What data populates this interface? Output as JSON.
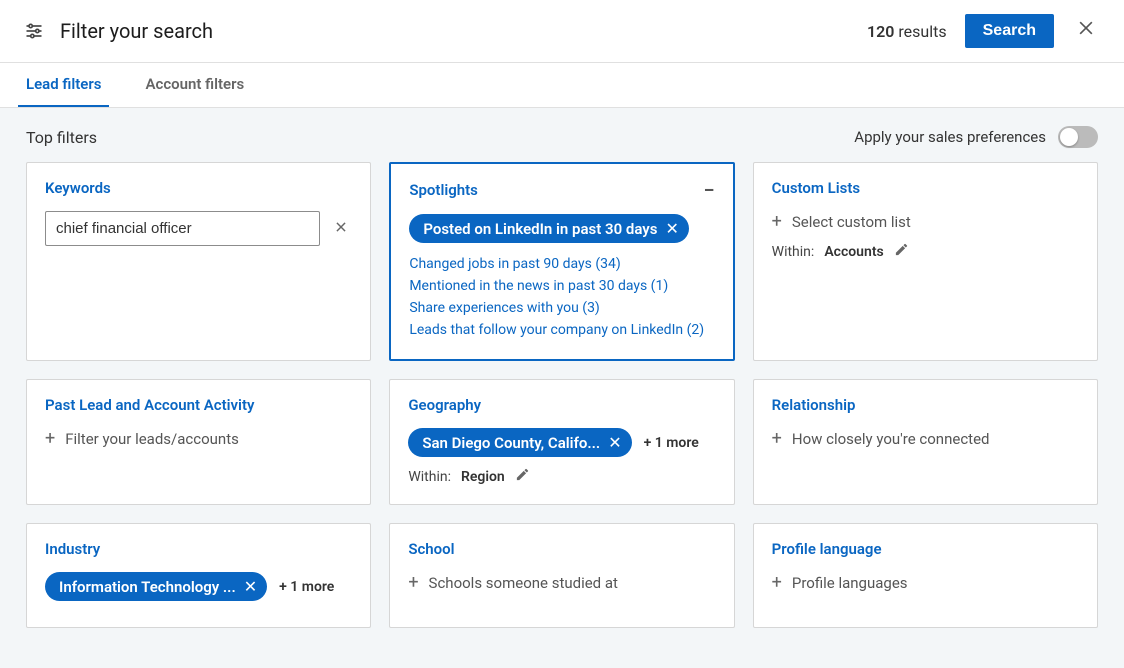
{
  "header": {
    "title": "Filter your search",
    "results_count": "120",
    "results_word": "results",
    "search_label": "Search"
  },
  "tabs": {
    "lead": "Lead filters",
    "account": "Account filters"
  },
  "topbar": {
    "title": "Top filters",
    "prefs_label": "Apply your sales preferences"
  },
  "keywords": {
    "title": "Keywords",
    "value": "chief financial officer"
  },
  "spotlights": {
    "title": "Spotlights",
    "chip": "Posted on LinkedIn in past 30 days",
    "links": [
      "Changed jobs in past 90 days (34)",
      "Mentioned in the news in past 30 days (1)",
      "Share experiences with you (3)",
      "Leads that follow your company on LinkedIn (2)"
    ]
  },
  "custom_lists": {
    "title": "Custom Lists",
    "hint": "Select custom list",
    "within_label": "Within:",
    "within_value": "Accounts"
  },
  "past_activity": {
    "title": "Past Lead and Account Activity",
    "hint": "Filter your leads/accounts"
  },
  "geography": {
    "title": "Geography",
    "chip": "San Diego County, Califo...",
    "more": "+ 1 more",
    "within_label": "Within:",
    "within_value": "Region"
  },
  "relationship": {
    "title": "Relationship",
    "hint": "How closely you're connected"
  },
  "industry": {
    "title": "Industry",
    "chip": "Information Technology ...",
    "more": "+ 1 more"
  },
  "school": {
    "title": "School",
    "hint": "Schools someone studied at"
  },
  "profile_language": {
    "title": "Profile language",
    "hint": "Profile languages"
  }
}
